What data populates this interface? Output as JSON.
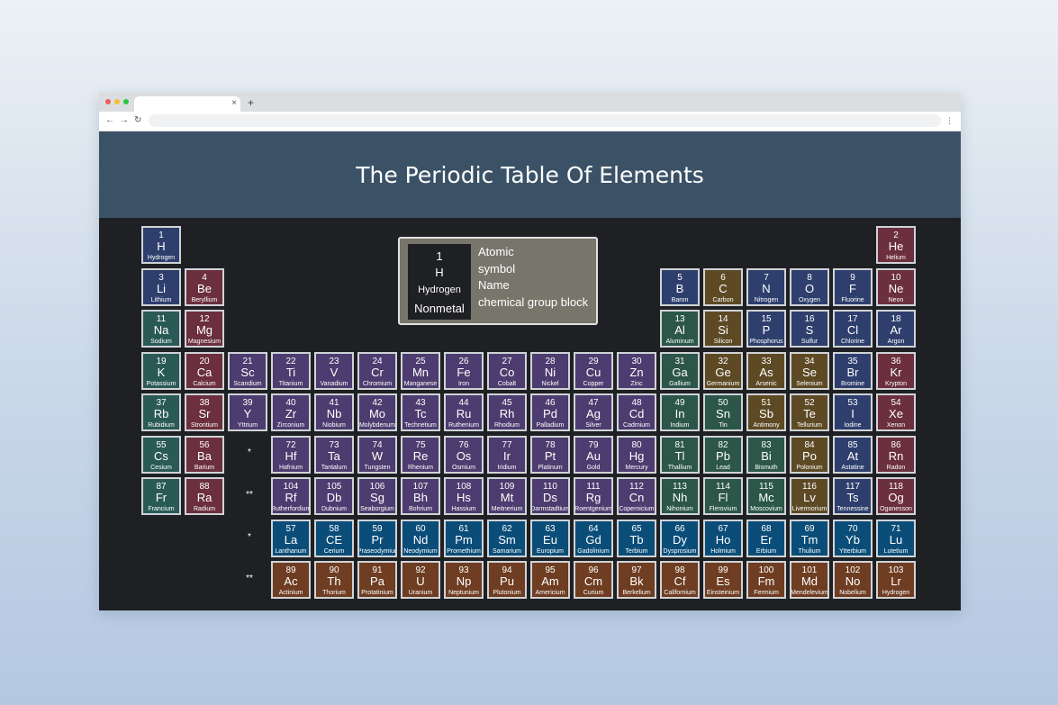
{
  "browser": {
    "tab_close": "×",
    "new_tab": "+",
    "back": "←",
    "forward": "→",
    "reload": "↻",
    "menu": "⋮",
    "dot_colors": [
      "#ee5f58",
      "#f5bd30",
      "#28c840"
    ]
  },
  "page": {
    "title": "The Periodic Table Of Elements"
  },
  "legend": {
    "example": {
      "number": "1",
      "symbol": "H",
      "name": "Hydrogen",
      "group": "Nonmetal"
    },
    "labels": [
      "Atomic",
      "symbol",
      "Name",
      "chemical group block"
    ]
  },
  "group_colors": {
    "nonmetal": "#2e3f6d",
    "noble": "#6b2f3d",
    "alkali": "#2a5a56",
    "alkaline": "#6b2f3d",
    "transition": "#4c3c6f",
    "post_transition": "#2b5648",
    "metalloid": "#5d4a25",
    "halogen": "#2e3f6d",
    "lanthanide": "#0b4d79",
    "actinide": "#6e3d22"
  },
  "series_markers": [
    "*",
    "**",
    "*",
    "**"
  ],
  "elements": [
    {
      "n": "1",
      "s": "H",
      "name": "Hydrogen",
      "g": "nonmetal",
      "c": 1,
      "r": 1
    },
    {
      "n": "2",
      "s": "He",
      "name": "Helium",
      "g": "noble",
      "c": 18,
      "r": 1
    },
    {
      "n": "3",
      "s": "Li",
      "name": "Lithium",
      "g": "nonmetal",
      "c": 1,
      "r": 2
    },
    {
      "n": "4",
      "s": "Be",
      "name": "Beryllium",
      "g": "alkaline",
      "c": 2,
      "r": 2
    },
    {
      "n": "5",
      "s": "B",
      "name": "Baron",
      "g": "nonmetal",
      "c": 13,
      "r": 2
    },
    {
      "n": "6",
      "s": "C",
      "name": "Carbon",
      "g": "metalloid",
      "c": 14,
      "r": 2
    },
    {
      "n": "7",
      "s": "N",
      "name": "Nitrogen",
      "g": "nonmetal",
      "c": 15,
      "r": 2
    },
    {
      "n": "8",
      "s": "O",
      "name": "Oxygen",
      "g": "nonmetal",
      "c": 16,
      "r": 2
    },
    {
      "n": "9",
      "s": "F",
      "name": "Fluorine",
      "g": "halogen",
      "c": 17,
      "r": 2
    },
    {
      "n": "10",
      "s": "Ne",
      "name": "Neon",
      "g": "noble",
      "c": 18,
      "r": 2
    },
    {
      "n": "11",
      "s": "Na",
      "name": "Sodium",
      "g": "alkali",
      "c": 1,
      "r": 3
    },
    {
      "n": "12",
      "s": "Mg",
      "name": "Magnesium",
      "g": "alkaline",
      "c": 2,
      "r": 3
    },
    {
      "n": "13",
      "s": "Al",
      "name": "Aluminum",
      "g": "post_transition",
      "c": 13,
      "r": 3
    },
    {
      "n": "14",
      "s": "Si",
      "name": "Silicon",
      "g": "metalloid",
      "c": 14,
      "r": 3
    },
    {
      "n": "15",
      "s": "P",
      "name": "Phosphorus",
      "g": "nonmetal",
      "c": 15,
      "r": 3
    },
    {
      "n": "16",
      "s": "S",
      "name": "Sulfur",
      "g": "nonmetal",
      "c": 16,
      "r": 3
    },
    {
      "n": "17",
      "s": "Cl",
      "name": "Chlorine",
      "g": "halogen",
      "c": 17,
      "r": 3
    },
    {
      "n": "18",
      "s": "Ar",
      "name": "Argon",
      "g": "nonmetal",
      "c": 18,
      "r": 3
    },
    {
      "n": "19",
      "s": "K",
      "name": "Potassium",
      "g": "alkali",
      "c": 1,
      "r": 4
    },
    {
      "n": "20",
      "s": "Ca",
      "name": "Calcium",
      "g": "alkaline",
      "c": 2,
      "r": 4
    },
    {
      "n": "21",
      "s": "Sc",
      "name": "Scandium",
      "g": "transition",
      "c": 3,
      "r": 4
    },
    {
      "n": "22",
      "s": "Ti",
      "name": "Titanium",
      "g": "transition",
      "c": 4,
      "r": 4
    },
    {
      "n": "23",
      "s": "V",
      "name": "Vanadium",
      "g": "transition",
      "c": 5,
      "r": 4
    },
    {
      "n": "24",
      "s": "Cr",
      "name": "Chromium",
      "g": "transition",
      "c": 6,
      "r": 4
    },
    {
      "n": "25",
      "s": "Mn",
      "name": "Manganese",
      "g": "transition",
      "c": 7,
      "r": 4
    },
    {
      "n": "26",
      "s": "Fe",
      "name": "Iron",
      "g": "transition",
      "c": 8,
      "r": 4
    },
    {
      "n": "27",
      "s": "Co",
      "name": "Cobalt",
      "g": "transition",
      "c": 9,
      "r": 4
    },
    {
      "n": "28",
      "s": "Ni",
      "name": "Nickel",
      "g": "transition",
      "c": 10,
      "r": 4
    },
    {
      "n": "29",
      "s": "Cu",
      "name": "Copper",
      "g": "transition",
      "c": 11,
      "r": 4
    },
    {
      "n": "30",
      "s": "Zn",
      "name": "Zinc",
      "g": "transition",
      "c": 12,
      "r": 4
    },
    {
      "n": "31",
      "s": "Ga",
      "name": "Gallium",
      "g": "post_transition",
      "c": 13,
      "r": 4
    },
    {
      "n": "32",
      "s": "Ge",
      "name": "Germanium",
      "g": "metalloid",
      "c": 14,
      "r": 4
    },
    {
      "n": "33",
      "s": "As",
      "name": "Arsenic",
      "g": "metalloid",
      "c": 15,
      "r": 4
    },
    {
      "n": "34",
      "s": "Se",
      "name": "Selenium",
      "g": "metalloid",
      "c": 16,
      "r": 4
    },
    {
      "n": "35",
      "s": "Br",
      "name": "Bromine",
      "g": "halogen",
      "c": 17,
      "r": 4
    },
    {
      "n": "36",
      "s": "Kr",
      "name": "Krypton",
      "g": "noble",
      "c": 18,
      "r": 4
    },
    {
      "n": "37",
      "s": "Rb",
      "name": "Rubidium",
      "g": "alkali",
      "c": 1,
      "r": 5
    },
    {
      "n": "38",
      "s": "Sr",
      "name": "Strontium",
      "g": "alkaline",
      "c": 2,
      "r": 5
    },
    {
      "n": "39",
      "s": "Y",
      "name": "Yttrium",
      "g": "transition",
      "c": 3,
      "r": 5
    },
    {
      "n": "40",
      "s": "Zr",
      "name": "Zirconium",
      "g": "transition",
      "c": 4,
      "r": 5
    },
    {
      "n": "41",
      "s": "Nb",
      "name": "Niobium",
      "g": "transition",
      "c": 5,
      "r": 5
    },
    {
      "n": "42",
      "s": "Mo",
      "name": "Molybdenum",
      "g": "transition",
      "c": 6,
      "r": 5
    },
    {
      "n": "43",
      "s": "Tc",
      "name": "Technetium",
      "g": "transition",
      "c": 7,
      "r": 5
    },
    {
      "n": "44",
      "s": "Ru",
      "name": "Ruthenium",
      "g": "transition",
      "c": 8,
      "r": 5
    },
    {
      "n": "45",
      "s": "Rh",
      "name": "Rhodium",
      "g": "transition",
      "c": 9,
      "r": 5
    },
    {
      "n": "46",
      "s": "Pd",
      "name": "Palladium",
      "g": "transition",
      "c": 10,
      "r": 5
    },
    {
      "n": "47",
      "s": "Ag",
      "name": "Silver",
      "g": "transition",
      "c": 11,
      "r": 5
    },
    {
      "n": "48",
      "s": "Cd",
      "name": "Cadmium",
      "g": "transition",
      "c": 12,
      "r": 5
    },
    {
      "n": "49",
      "s": "In",
      "name": "Indium",
      "g": "post_transition",
      "c": 13,
      "r": 5
    },
    {
      "n": "50",
      "s": "Sn",
      "name": "Tin",
      "g": "post_transition",
      "c": 14,
      "r": 5
    },
    {
      "n": "51",
      "s": "Sb",
      "name": "Antimony",
      "g": "metalloid",
      "c": 15,
      "r": 5
    },
    {
      "n": "52",
      "s": "Te",
      "name": "Tellurium",
      "g": "metalloid",
      "c": 16,
      "r": 5
    },
    {
      "n": "53",
      "s": "I",
      "name": "Iodine",
      "g": "halogen",
      "c": 17,
      "r": 5
    },
    {
      "n": "54",
      "s": "Xe",
      "name": "Xenon",
      "g": "noble",
      "c": 18,
      "r": 5
    },
    {
      "n": "55",
      "s": "Cs",
      "name": "Cesium",
      "g": "alkali",
      "c": 1,
      "r": 6
    },
    {
      "n": "56",
      "s": "Ba",
      "name": "Barium",
      "g": "alkaline",
      "c": 2,
      "r": 6
    },
    {
      "n": "72",
      "s": "Hf",
      "name": "Hafnium",
      "g": "transition",
      "c": 4,
      "r": 6
    },
    {
      "n": "73",
      "s": "Ta",
      "name": "Tantalum",
      "g": "transition",
      "c": 5,
      "r": 6
    },
    {
      "n": "74",
      "s": "W",
      "name": "Tungsten",
      "g": "transition",
      "c": 6,
      "r": 6
    },
    {
      "n": "75",
      "s": "Re",
      "name": "Rhenium",
      "g": "transition",
      "c": 7,
      "r": 6
    },
    {
      "n": "76",
      "s": "Os",
      "name": "Osmium",
      "g": "transition",
      "c": 8,
      "r": 6
    },
    {
      "n": "77",
      "s": "Ir",
      "name": "Iridium",
      "g": "transition",
      "c": 9,
      "r": 6
    },
    {
      "n": "78",
      "s": "Pt",
      "name": "Platinum",
      "g": "transition",
      "c": 10,
      "r": 6
    },
    {
      "n": "79",
      "s": "Au",
      "name": "Gold",
      "g": "transition",
      "c": 11,
      "r": 6
    },
    {
      "n": "80",
      "s": "Hg",
      "name": "Mercury",
      "g": "transition",
      "c": 12,
      "r": 6
    },
    {
      "n": "81",
      "s": "Tl",
      "name": "Thallium",
      "g": "post_transition",
      "c": 13,
      "r": 6
    },
    {
      "n": "82",
      "s": "Pb",
      "name": "Lead",
      "g": "post_transition",
      "c": 14,
      "r": 6
    },
    {
      "n": "83",
      "s": "Bi",
      "name": "Bismuth",
      "g": "post_transition",
      "c": 15,
      "r": 6
    },
    {
      "n": "84",
      "s": "Po",
      "name": "Polonium",
      "g": "metalloid",
      "c": 16,
      "r": 6
    },
    {
      "n": "85",
      "s": "At",
      "name": "Astatine",
      "g": "halogen",
      "c": 17,
      "r": 6
    },
    {
      "n": "86",
      "s": "Rn",
      "name": "Radon",
      "g": "noble",
      "c": 18,
      "r": 6
    },
    {
      "n": "87",
      "s": "Fr",
      "name": "Francium",
      "g": "alkali",
      "c": 1,
      "r": 7
    },
    {
      "n": "88",
      "s": "Ra",
      "name": "Radium",
      "g": "alkaline",
      "c": 2,
      "r": 7
    },
    {
      "n": "104",
      "s": "Rf",
      "name": "Rutherfordium",
      "g": "transition",
      "c": 4,
      "r": 7
    },
    {
      "n": "105",
      "s": "Db",
      "name": "Dubnium",
      "g": "transition",
      "c": 5,
      "r": 7
    },
    {
      "n": "106",
      "s": "Sg",
      "name": "Seaborgium",
      "g": "transition",
      "c": 6,
      "r": 7
    },
    {
      "n": "107",
      "s": "Bh",
      "name": "Bohrium",
      "g": "transition",
      "c": 7,
      "r": 7
    },
    {
      "n": "108",
      "s": "Hs",
      "name": "Hassium",
      "g": "transition",
      "c": 8,
      "r": 7
    },
    {
      "n": "109",
      "s": "Mt",
      "name": "Meitnerium",
      "g": "transition",
      "c": 9,
      "r": 7
    },
    {
      "n": "110",
      "s": "Ds",
      "name": "Darmstadtium",
      "g": "transition",
      "c": 10,
      "r": 7
    },
    {
      "n": "111",
      "s": "Rg",
      "name": "Roentgenium",
      "g": "transition",
      "c": 11,
      "r": 7
    },
    {
      "n": "112",
      "s": "Cn",
      "name": "Copernicium",
      "g": "transition",
      "c": 12,
      "r": 7
    },
    {
      "n": "113",
      "s": "Nh",
      "name": "Nihonium",
      "g": "post_transition",
      "c": 13,
      "r": 7
    },
    {
      "n": "114",
      "s": "Fl",
      "name": "Flerovium",
      "g": "post_transition",
      "c": 14,
      "r": 7
    },
    {
      "n": "115",
      "s": "Mc",
      "name": "Moscovium",
      "g": "post_transition",
      "c": 15,
      "r": 7
    },
    {
      "n": "116",
      "s": "Lv",
      "name": "Livermorium",
      "g": "metalloid",
      "c": 16,
      "r": 7
    },
    {
      "n": "117",
      "s": "Ts",
      "name": "Tennessine",
      "g": "halogen",
      "c": 17,
      "r": 7
    },
    {
      "n": "118",
      "s": "Og",
      "name": "Oganesson",
      "g": "noble",
      "c": 18,
      "r": 7
    },
    {
      "n": "57",
      "s": "La",
      "name": "Lanthanum",
      "g": "lanthanide",
      "c": 4,
      "r": 8
    },
    {
      "n": "58",
      "s": "CE",
      "name": "Cerium",
      "g": "lanthanide",
      "c": 5,
      "r": 8
    },
    {
      "n": "59",
      "s": "Pr",
      "name": "Praseodymium",
      "g": "lanthanide",
      "c": 6,
      "r": 8
    },
    {
      "n": "60",
      "s": "Nd",
      "name": "Neodymium",
      "g": "lanthanide",
      "c": 7,
      "r": 8
    },
    {
      "n": "61",
      "s": "Pm",
      "name": "Promethium",
      "g": "lanthanide",
      "c": 8,
      "r": 8
    },
    {
      "n": "62",
      "s": "Sm",
      "name": "Samarium",
      "g": "lanthanide",
      "c": 9,
      "r": 8
    },
    {
      "n": "63",
      "s": "Eu",
      "name": "Europium",
      "g": "lanthanide",
      "c": 10,
      "r": 8
    },
    {
      "n": "64",
      "s": "Gd",
      "name": "Gadolinium",
      "g": "lanthanide",
      "c": 11,
      "r": 8
    },
    {
      "n": "65",
      "s": "Tb",
      "name": "Terbium",
      "g": "lanthanide",
      "c": 12,
      "r": 8
    },
    {
      "n": "66",
      "s": "Dy",
      "name": "Dysprosium",
      "g": "lanthanide",
      "c": 13,
      "r": 8
    },
    {
      "n": "67",
      "s": "Ho",
      "name": "Holmium",
      "g": "lanthanide",
      "c": 14,
      "r": 8
    },
    {
      "n": "68",
      "s": "Er",
      "name": "Erbium",
      "g": "lanthanide",
      "c": 15,
      "r": 8
    },
    {
      "n": "69",
      "s": "Tm",
      "name": "Thulium",
      "g": "lanthanide",
      "c": 16,
      "r": 8
    },
    {
      "n": "70",
      "s": "Yb",
      "name": "Ytterbium",
      "g": "lanthanide",
      "c": 17,
      "r": 8
    },
    {
      "n": "71",
      "s": "Lu",
      "name": "Lutetium",
      "g": "lanthanide",
      "c": 18,
      "r": 8
    },
    {
      "n": "89",
      "s": "Ac",
      "name": "Actinium",
      "g": "actinide",
      "c": 4,
      "r": 9
    },
    {
      "n": "90",
      "s": "Th",
      "name": "Thorium",
      "g": "actinide",
      "c": 5,
      "r": 9
    },
    {
      "n": "91",
      "s": "Pa",
      "name": "Protatinium",
      "g": "actinide",
      "c": 6,
      "r": 9
    },
    {
      "n": "92",
      "s": "U",
      "name": "Uranium",
      "g": "actinide",
      "c": 7,
      "r": 9
    },
    {
      "n": "93",
      "s": "Np",
      "name": "Neptunium",
      "g": "actinide",
      "c": 8,
      "r": 9
    },
    {
      "n": "94",
      "s": "Pu",
      "name": "Plutonium",
      "g": "actinide",
      "c": 9,
      "r": 9
    },
    {
      "n": "95",
      "s": "Am",
      "name": "Americium",
      "g": "actinide",
      "c": 10,
      "r": 9
    },
    {
      "n": "96",
      "s": "Cm",
      "name": "Curium",
      "g": "actinide",
      "c": 11,
      "r": 9
    },
    {
      "n": "97",
      "s": "Bk",
      "name": "Berkelium",
      "g": "actinide",
      "c": 12,
      "r": 9
    },
    {
      "n": "98",
      "s": "Cf",
      "name": "Californium",
      "g": "actinide",
      "c": 13,
      "r": 9
    },
    {
      "n": "99",
      "s": "Es",
      "name": "Einsteinium",
      "g": "actinide",
      "c": 14,
      "r": 9
    },
    {
      "n": "100",
      "s": "Fm",
      "name": "Fermium",
      "g": "actinide",
      "c": 15,
      "r": 9
    },
    {
      "n": "101",
      "s": "Md",
      "name": "Mendelevium",
      "g": "actinide",
      "c": 16,
      "r": 9
    },
    {
      "n": "102",
      "s": "No",
      "name": "Nobelium",
      "g": "actinide",
      "c": 17,
      "r": 9
    },
    {
      "n": "103",
      "s": "Lr",
      "name": "Hydrogen",
      "g": "actinide",
      "c": 18,
      "r": 9
    }
  ]
}
